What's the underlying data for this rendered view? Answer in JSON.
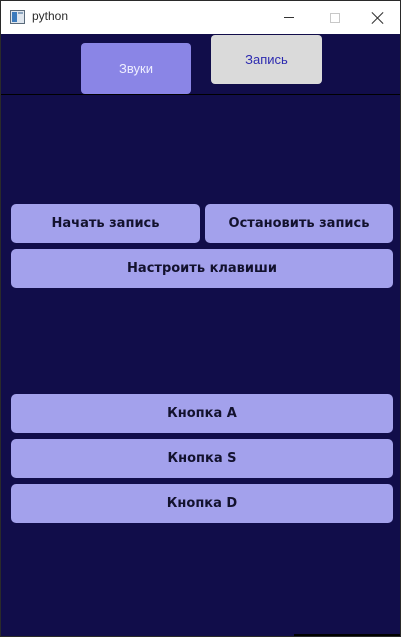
{
  "window": {
    "title": "python",
    "icon": "python-window-icon",
    "controls": [
      "minimize-icon",
      "maximize-icon",
      "close-icon"
    ]
  },
  "tabs": [
    {
      "label": "Звуки",
      "active": true
    },
    {
      "label": "Запись",
      "active": false
    }
  ],
  "recording": {
    "start_label": "Начать запись",
    "stop_label": "Остановить запись",
    "configure_keys_label": "Настроить клавиши"
  },
  "keys": [
    {
      "label": "Кнопка A"
    },
    {
      "label": "Кнопка S"
    },
    {
      "label": "Кнопка D"
    }
  ],
  "colors": {
    "background": "#110d4a",
    "button": "#a3a1ec",
    "active_tab": "#8a85e6",
    "inactive_tab": "#dadada"
  }
}
